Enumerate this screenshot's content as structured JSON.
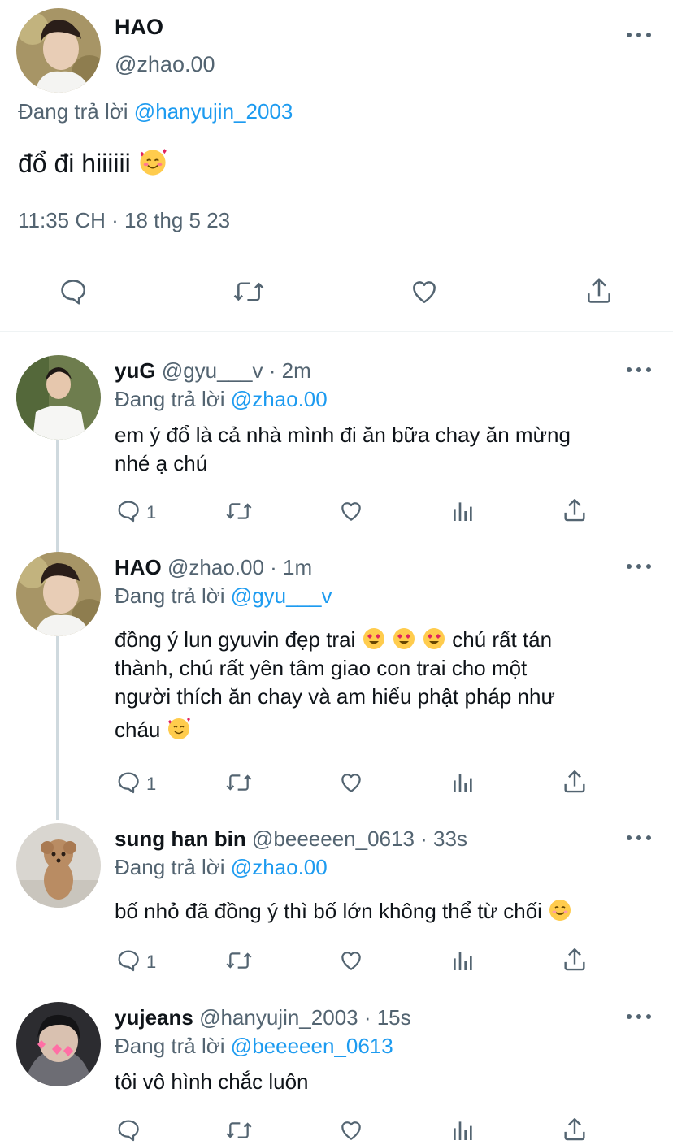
{
  "main_tweet": {
    "name": "HAO",
    "handle": "@zhao.00",
    "reply_prefix": "Đang trả lời",
    "reply_to": "@hanyujin_2003",
    "text": "đổ đi hiiiiii",
    "timestamp": "11:35 CH · 18 thg 5 23"
  },
  "replies": [
    {
      "name": "yuG",
      "handle": "@gyu___v · 2m",
      "reply_prefix": "Đang trả lời",
      "reply_to": "@zhao.00",
      "lines": [
        "em ý đổ là cả nhà mình đi ăn bữa chay ăn mừng",
        "nhé ạ chú"
      ],
      "reply_count": "1"
    },
    {
      "name": "HAO",
      "handle": "@zhao.00 · 1m",
      "reply_prefix": "Đang trả lời",
      "reply_to": "@gyu___v",
      "line1": "đồng ý lun gyuvin đẹp trai",
      "line1_tail": "chú rất tán",
      "line2": "thành, chú rất yên tâm giao con trai cho một",
      "line3": "người thích ăn chay và am hiểu phật pháp như",
      "line4": "cháu",
      "reply_count": "1"
    },
    {
      "name": "sung han bin",
      "handle": "@beeeeen_0613 · 33s",
      "reply_prefix": "Đang trả lời",
      "reply_to": "@zhao.00",
      "text": "bố nhỏ đã đồng ý thì bố lớn không thể từ chối",
      "reply_count": "1"
    },
    {
      "name": "yujeans",
      "handle": "@hanyujin_2003 · 15s",
      "reply_prefix": "Đang trả lời",
      "reply_to": "@beeeeen_0613",
      "text": "tôi vô hình chắc luôn"
    }
  ],
  "icons": {
    "reply": "reply-icon",
    "retweet": "retweet-icon",
    "like": "heart-icon",
    "views": "views-icon",
    "share": "share-icon",
    "more": "more-icon"
  },
  "colors": {
    "accent": "#1d9bf0",
    "muted": "#536471",
    "text": "#0f1419"
  }
}
